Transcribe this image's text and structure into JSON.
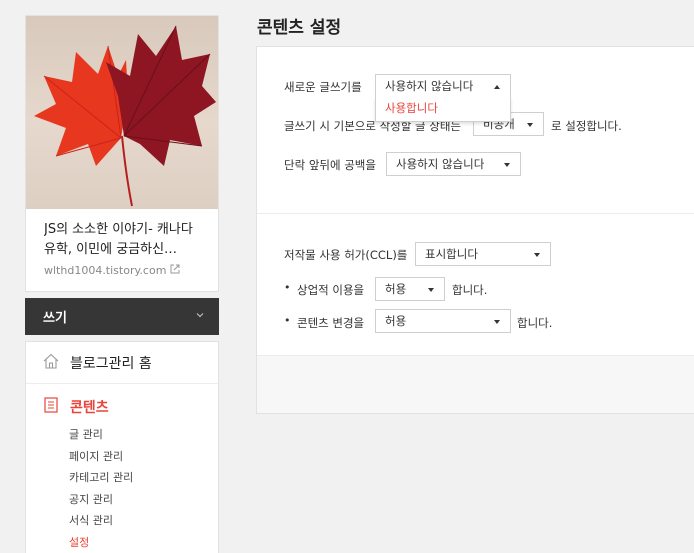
{
  "sidebar": {
    "blog_title": "JS의 소소한 이야기- 캐나다 유학, 이민에 궁금하신…",
    "blog_url": "wlthd1004.tistory.com",
    "write_label": "쓰기",
    "home_label": "블로그관리 홈",
    "contents_label": "콘텐츠",
    "submenu": [
      "글 관리",
      "페이지 관리",
      "카테고리 관리",
      "공지 관리",
      "서식 관리",
      "설정"
    ]
  },
  "main": {
    "page_title": "콘텐츠 설정",
    "new_editor_label": "새로운 글쓰기를",
    "new_editor_value": "사용하지 않습니다",
    "new_editor_option": "사용합니다",
    "default_visibility_label": "글쓰기 시 기본으로 작성할 글 상태는",
    "default_visibility_value": "비공개",
    "default_visibility_suffix": "로 설정합니다.",
    "paragraph_space_label": "단락 앞뒤에 공백을",
    "paragraph_space_value": "사용하지 않습니다",
    "ccl_label": "저작물 사용 허가(CCL)를",
    "ccl_value": "표시합니다",
    "commercial_label": "상업적 이용을",
    "commercial_value": "허용",
    "commercial_suffix": "합니다.",
    "modify_label": "콘텐츠 변경을",
    "modify_value": "허용",
    "modify_suffix": "합니다."
  },
  "colors": {
    "accent": "#e8443a",
    "write_bg": "#363636"
  }
}
